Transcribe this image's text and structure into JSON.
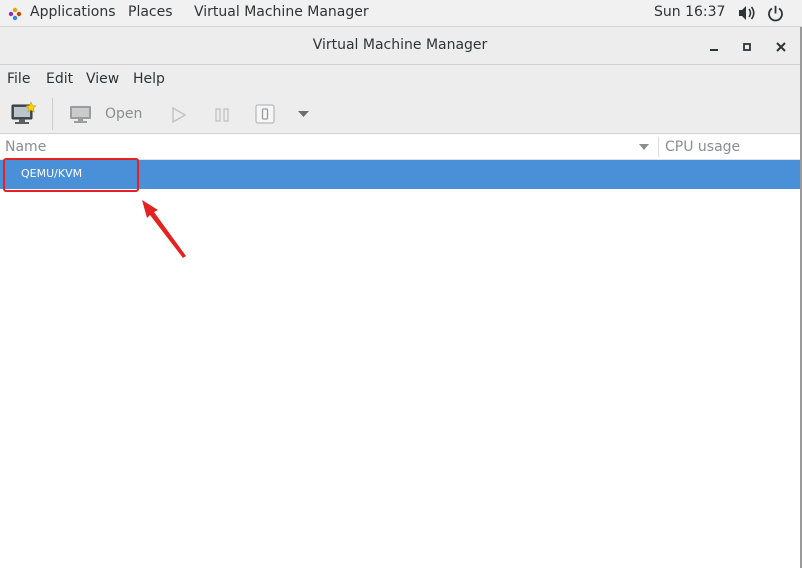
{
  "topbar": {
    "applications": "Applications",
    "places": "Places",
    "active_app": "Virtual Machine Manager",
    "clock": "Sun 16:37"
  },
  "window": {
    "title": "Virtual Machine Manager"
  },
  "menubar": {
    "file": "File",
    "edit": "Edit",
    "view": "View",
    "help": "Help"
  },
  "toolbar": {
    "open_label": "Open"
  },
  "list": {
    "columns": [
      "Name",
      "CPU usage"
    ],
    "rows": [
      {
        "name": "QEMU/KVM",
        "selected": true
      }
    ]
  },
  "colors": {
    "selection": "#4a90d9",
    "annotation": "#e52222"
  },
  "icons": [
    "applications-icon",
    "volume-icon",
    "power-icon",
    "minimize-icon",
    "maximize-icon",
    "close-icon",
    "new-vm-icon",
    "open-console-icon",
    "run-icon",
    "pause-icon",
    "shutdown-icon",
    "shutdown-menu-icon",
    "sort-arrow-icon"
  ]
}
